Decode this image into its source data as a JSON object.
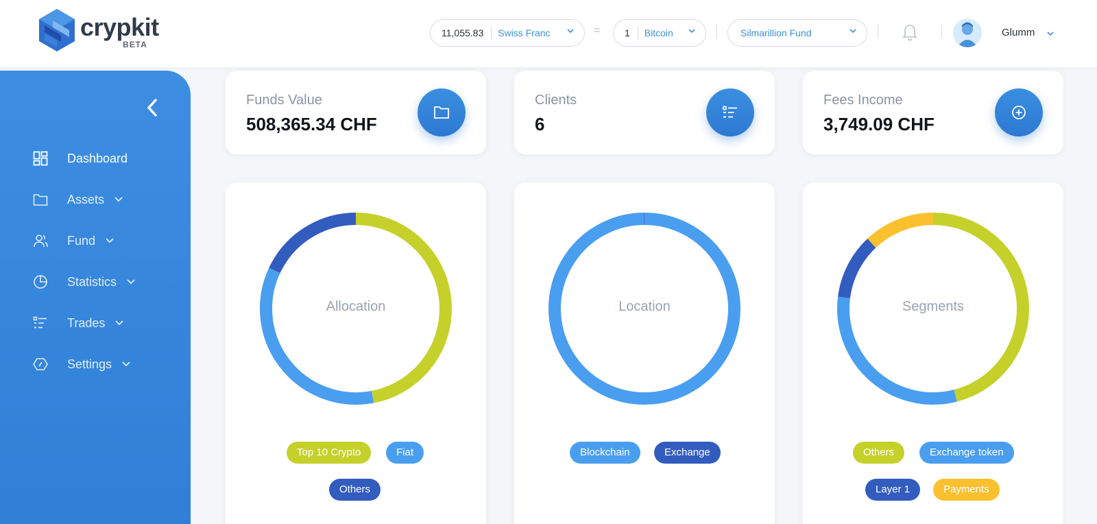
{
  "header": {
    "brand": "crypkit",
    "brand_tag": "BETA",
    "amount": "11,055.83",
    "currency": "Swiss Franc",
    "equals": "=",
    "crypto_amount": "1",
    "crypto": "Bitcoin",
    "fund": "Silmarillion Fund",
    "username": "Glumm"
  },
  "sidebar": {
    "items": [
      {
        "label": "Dashboard",
        "icon": "dashboard-icon"
      },
      {
        "label": "Assets",
        "icon": "folder-icon"
      },
      {
        "label": "Fund",
        "icon": "users-icon"
      },
      {
        "label": "Statistics",
        "icon": "pie-chart-icon"
      },
      {
        "label": "Trades",
        "icon": "list-icon"
      },
      {
        "label": "Settings",
        "icon": "settings-icon"
      }
    ]
  },
  "stats": [
    {
      "title": "Funds Value",
      "value": "508,365.34 CHF",
      "icon": "folder-icon"
    },
    {
      "title": "Clients",
      "value": "6",
      "icon": "list-icon"
    },
    {
      "title": "Fees Income",
      "value": "3,749.09 CHF",
      "icon": "plus-circle-icon"
    }
  ],
  "colors": {
    "lime": "#c5d12a",
    "blue": "#4a9ef0",
    "navy": "#335cbf",
    "yellow": "#fbc02d",
    "primary": "#2f7fd6"
  },
  "charts": [
    {
      "title": "Allocation",
      "segments": [
        {
          "label": "Top 10 Crypto",
          "share": 0.47,
          "color": "#c5d12a"
        },
        {
          "label": "Fiat",
          "share": 0.35,
          "color": "#4a9ef0"
        },
        {
          "label": "Others",
          "share": 0.18,
          "color": "#335cbf"
        }
      ]
    },
    {
      "title": "Location",
      "segments": [
        {
          "label": "Blockchain",
          "share": 0.999,
          "color": "#4a9ef0"
        },
        {
          "label": "Exchange",
          "share": 0.001,
          "color": "#335cbf"
        }
      ]
    },
    {
      "title": "Segments",
      "segments": [
        {
          "label": "Others",
          "share": 0.46,
          "color": "#c5d12a"
        },
        {
          "label": "Exchange token",
          "share": 0.31,
          "color": "#4a9ef0"
        },
        {
          "label": "Layer 1",
          "share": 0.11,
          "color": "#335cbf"
        },
        {
          "label": "Payments",
          "share": 0.12,
          "color": "#fbc02d"
        }
      ]
    }
  ]
}
